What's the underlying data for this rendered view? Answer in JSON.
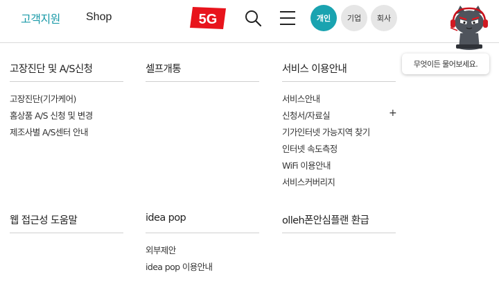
{
  "header": {
    "support_label": "고객지원",
    "shop_label": "Shop",
    "logo_text": "5G",
    "segments": {
      "personal": "개인",
      "business": "기업",
      "company": "회사"
    }
  },
  "chatbot": {
    "bubble_text": "무엇이든 물어보세요."
  },
  "colors": {
    "accent": "#1aa3b0",
    "logo_red": "#e8141c"
  },
  "icons": [
    "search-icon",
    "hamburger-menu-icon",
    "chatbot-cat-icon",
    "plus-icon"
  ],
  "sections": {
    "s1": {
      "title": "고장진단 및 A/S신청",
      "links": [
        "고장진단(기가케어)",
        "홈상품 A/S 신청 및 변경",
        "제조사별 A/S센터 안내"
      ]
    },
    "s2": {
      "title": "셀프개통",
      "links": []
    },
    "s3": {
      "title": "서비스 이용안내",
      "links": [
        "서비스안내",
        "신청서/자료실",
        "기가인터넷 가능지역 찾기",
        "인터넷 속도측정",
        "WiFi 이용안내",
        "서비스커버리지"
      ],
      "expand_symbol": "+"
    },
    "s4": {
      "title": "웹 접근성 도움말",
      "links": []
    },
    "s5": {
      "title": "idea pop",
      "links": [
        "외부제안",
        "idea pop 이용안내"
      ]
    },
    "s6": {
      "title": "olleh폰안심플랜 환급",
      "links": []
    }
  }
}
